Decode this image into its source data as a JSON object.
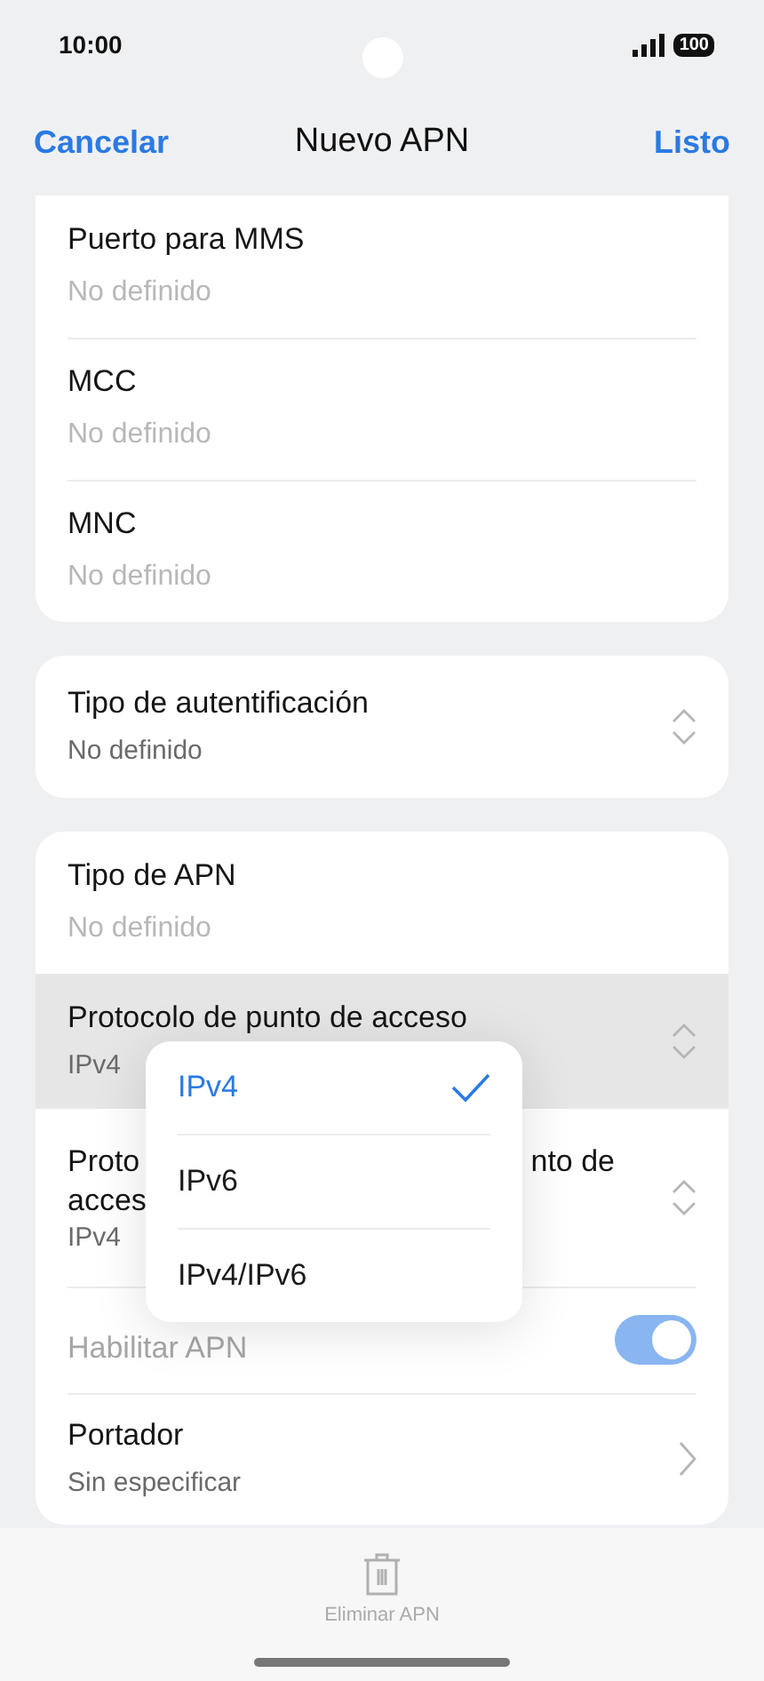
{
  "status_bar": {
    "time": "10:00",
    "battery": "100"
  },
  "header": {
    "cancel": "Cancelar",
    "title": "Nuevo APN",
    "done": "Listo"
  },
  "sections": [
    {
      "cut_top": true,
      "rows": [
        {
          "kind": "field",
          "label": "Puerto para MMS",
          "placeholder": "No definido"
        },
        {
          "kind": "field",
          "label": "MCC",
          "placeholder": "No definido"
        },
        {
          "kind": "field",
          "label": "MNC",
          "placeholder": "No definido"
        }
      ]
    },
    {
      "cut_top": false,
      "rows": [
        {
          "kind": "select",
          "label": "Tipo de autentificación",
          "value": "No definido",
          "pressed": false
        }
      ]
    },
    {
      "cut_top": false,
      "rows": [
        {
          "kind": "field",
          "label": "Tipo de APN",
          "placeholder": "No definido"
        },
        {
          "kind": "select",
          "label": "Protocolo de punto de acceso",
          "value": "IPv4",
          "pressed": true
        },
        {
          "kind": "covered",
          "label_parts": [
            "Proto",
            "nto de",
            "acces"
          ],
          "value": "IPv4"
        },
        {
          "kind": "toggle",
          "label": "Habilitar APN",
          "on": true,
          "disabled": true
        },
        {
          "kind": "link",
          "label": "Portador",
          "value": "Sin especificar"
        }
      ]
    }
  ],
  "popup": {
    "options": [
      {
        "label": "IPv4",
        "selected": true
      },
      {
        "label": "IPv6",
        "selected": false
      },
      {
        "label": "IPv4/IPv6",
        "selected": false
      }
    ]
  },
  "bottom_bar": {
    "action": "Eliminar APN"
  }
}
